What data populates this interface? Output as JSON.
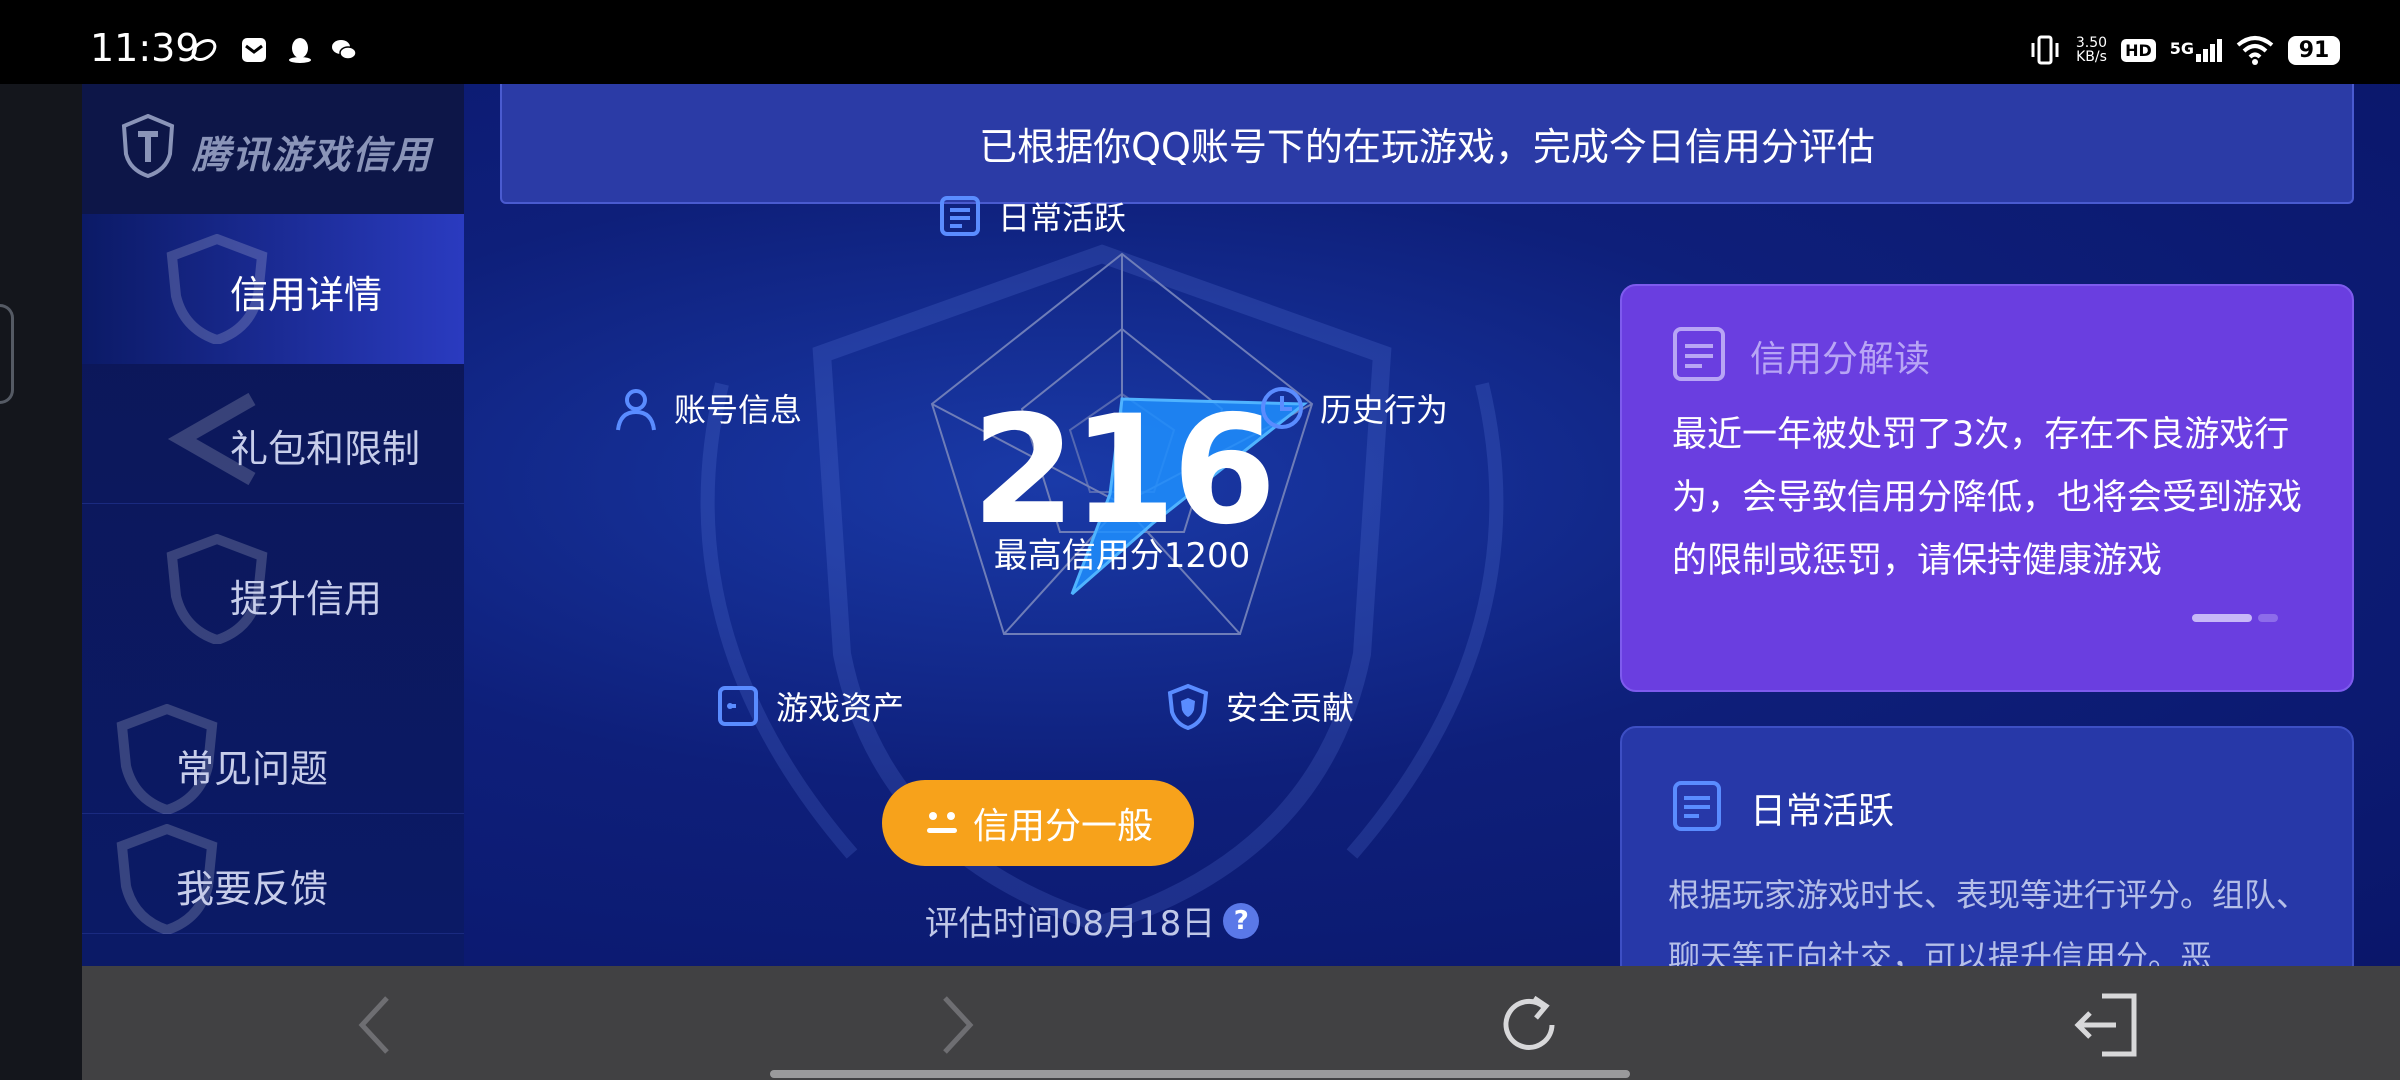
{
  "status_bar": {
    "time": "11:39",
    "net_speed_value": "3.50",
    "net_speed_unit": "KB/s",
    "hd": "HD",
    "network": "5G",
    "battery": "91"
  },
  "sidebar": {
    "logo_text": "腾讯游戏信用",
    "items": [
      {
        "label": "信用详情",
        "active": true
      },
      {
        "label": "礼包和限制"
      },
      {
        "label": "提升信用"
      },
      {
        "label": "常见问题"
      },
      {
        "label": "我要反馈"
      }
    ]
  },
  "banner": {
    "text": "已根据你QQ账号下的在玩游戏，完成今日信用分评估"
  },
  "radar": {
    "dimensions": [
      {
        "label": "日常活跃",
        "icon": "document-icon"
      },
      {
        "label": "历史行为",
        "icon": "clock-icon"
      },
      {
        "label": "安全贡献",
        "icon": "shield-icon"
      },
      {
        "label": "游戏资产",
        "icon": "wallet-icon"
      },
      {
        "label": "账号信息",
        "icon": "user-icon"
      }
    ],
    "score": "216",
    "max_score_text": "最高信用分1200",
    "level_label": "信用分一般",
    "eval_time": "评估时间08月18日"
  },
  "interpret_card": {
    "title": "信用分解读",
    "body": "最近一年被处罚了3次，存在不良游戏行为，会导致信用分降低，也将会受到游戏的限制或惩罚，请保持健康游戏"
  },
  "daily_card": {
    "title": "日常活跃",
    "body": "根据玩家游戏时长、表现等进行评分。组队、聊天等正向社交，可以提升信用分。恶"
  },
  "colors": {
    "accent_orange": "#f7a21b",
    "card_purple": "#6a3ee0",
    "radar_fill": "#1e90ff"
  }
}
